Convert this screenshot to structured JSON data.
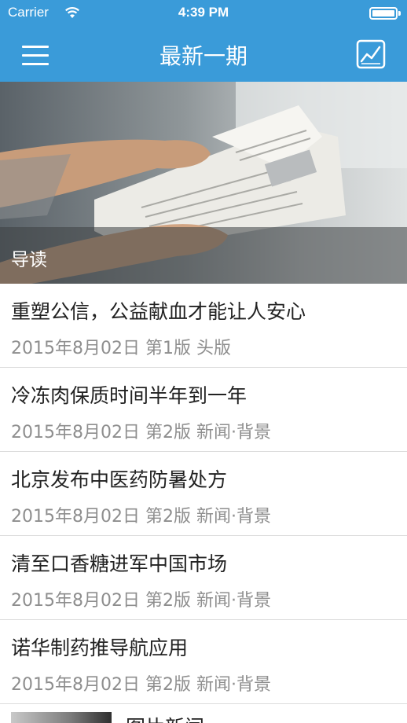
{
  "status_bar": {
    "carrier": "Carrier",
    "time": "4:39 PM"
  },
  "nav": {
    "title": "最新一期",
    "menu_icon": "hamburger-menu-icon",
    "chart_icon": "line-chart-icon"
  },
  "hero": {
    "caption": "导读"
  },
  "articles": [
    {
      "title": "重塑公信，公益献血才能让人安心",
      "meta": "2015年8月02日 第1版 头版"
    },
    {
      "title": "冷冻肉保质时间半年到一年",
      "meta": "2015年8月02日 第2版 新闻·背景"
    },
    {
      "title": "北京发布中医药防暑处方",
      "meta": "2015年8月02日 第2版 新闻·背景"
    },
    {
      "title": "清至口香糖进军中国市场",
      "meta": "2015年8月02日 第2版 新闻·背景"
    },
    {
      "title": "诺华制药推导航应用",
      "meta": "2015年8月02日 第2版 新闻·背景"
    }
  ],
  "partial_article": {
    "title": "图片新闻"
  },
  "colors": {
    "brand": "#3a9bd9",
    "title_text": "#222222",
    "meta_text": "#8e8e8e",
    "divider": "#dcdcdc"
  }
}
